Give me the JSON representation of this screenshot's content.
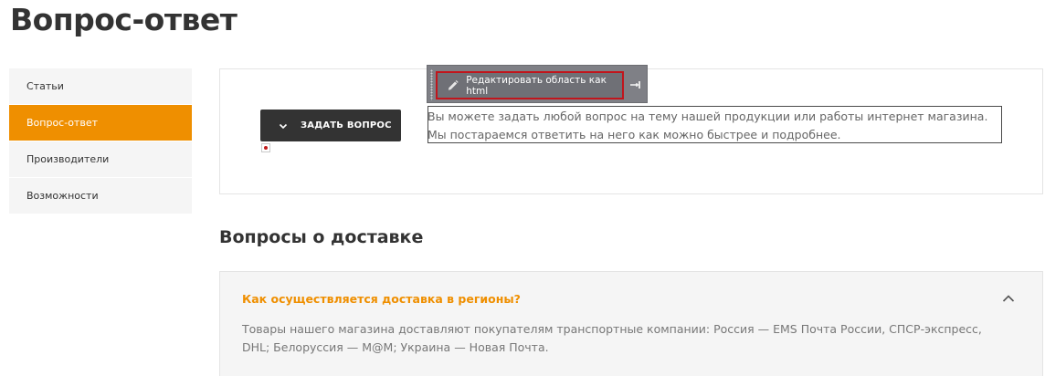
{
  "page": {
    "title": "Вопрос-ответ"
  },
  "sidebar": {
    "items": [
      {
        "label": "Статьи",
        "active": false
      },
      {
        "label": "Вопрос-ответ",
        "active": true
      },
      {
        "label": "Производители",
        "active": false
      },
      {
        "label": "Возможности",
        "active": false
      }
    ]
  },
  "ask": {
    "button_label": "ЗАДАТЬ ВОПРОС",
    "text_line_1": "Вы можете задать любой вопрос на тему нашей продукции или работы интернет магазина.",
    "text_line_2": "Мы постараемся ответить на него как можно быстрее и подробнее."
  },
  "edit_toolbar": {
    "edit_html_label": "Редактировать область как html"
  },
  "faq": {
    "section_title": "Вопросы о доставке",
    "items": [
      {
        "question": "Как осуществляется доставка в регионы?",
        "answer": "Товары нашего магазина доставляют покупателям транспортные компании: Россия — EMS Почта России, СПСР-экспресс, DHL; Белоруссия — М@М; Украина — Новая Почта.",
        "expanded": true
      }
    ]
  },
  "colors": {
    "accent": "#ef8f00",
    "dark_button": "#333333",
    "sidebar_bg": "#f5f5f5",
    "toolbar_bg": "#7f8086",
    "toolbar_highlight": "#c1151c"
  },
  "icons": {
    "ask_button": "chevron-down-icon",
    "edit_button": "pencil-icon",
    "pin": "pin-icon",
    "faq_toggle": "chevron-up-icon",
    "marker": "red-dot-icon"
  }
}
